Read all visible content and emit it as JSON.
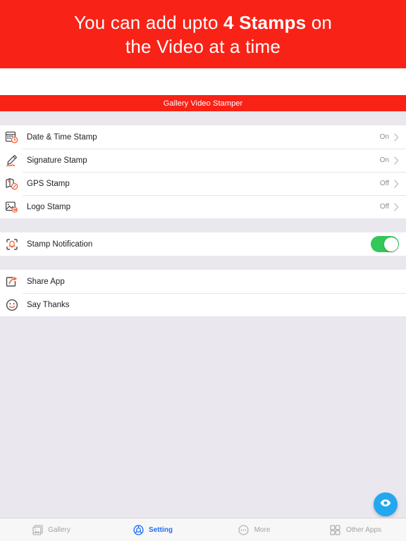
{
  "promo": {
    "line1_pre": "You can add upto ",
    "line1_strong": "4 Stamps",
    "line1_post": " on",
    "line2": "the Video at a time"
  },
  "navbar": {
    "title": "Gallery Video Stamper"
  },
  "settings": {
    "stamp_group": [
      {
        "icon": "calendar-clock-icon",
        "label": "Date & Time Stamp",
        "value": "On"
      },
      {
        "icon": "signature-pen-icon",
        "label": "Signature Stamp",
        "value": "On"
      },
      {
        "icon": "map-location-icon",
        "label": "GPS Stamp",
        "value": "Off"
      },
      {
        "icon": "photo-logo-icon",
        "label": "Logo Stamp",
        "value": "Off"
      }
    ],
    "notification_group": [
      {
        "icon": "bell-frame-icon",
        "label": "Stamp Notification",
        "toggle": "on"
      }
    ],
    "about_group": [
      {
        "icon": "share-arrow-icon",
        "label": "Share App"
      },
      {
        "icon": "smiley-face-icon",
        "label": "Say Thanks"
      }
    ]
  },
  "fab": {
    "icon": "eye-icon"
  },
  "tabbar": {
    "tabs": [
      {
        "icon": "gallery-photos-icon",
        "label": "Gallery",
        "active": false
      },
      {
        "icon": "settings-gear-icon",
        "label": "Setting",
        "active": true
      },
      {
        "icon": "more-dots-icon",
        "label": "More",
        "active": false
      },
      {
        "icon": "grid-apps-icon",
        "label": "Other Apps",
        "active": false
      }
    ]
  },
  "colors": {
    "brand_red": "#F92217",
    "background": "#EAE8EE",
    "toggle_green": "#34C759",
    "fab_blue": "#22A7F0",
    "tab_active_blue": "#1E6EF5",
    "icon_orange": "#F4663C",
    "icon_dark": "#4A4A52"
  }
}
